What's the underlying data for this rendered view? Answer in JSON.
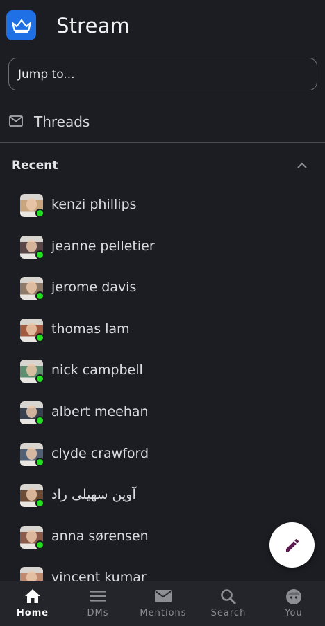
{
  "app": {
    "title": "Stream",
    "brand_color": "#1f6fe5"
  },
  "jump": {
    "placeholder": "Jump to..."
  },
  "threads": {
    "label": "Threads",
    "icon": "mail-icon"
  },
  "recent": {
    "heading": "Recent",
    "toggle_icon": "chevron-up-icon"
  },
  "dms": [
    {
      "name": "kenzi phillips",
      "online": true,
      "avatar_color": "#c9a57d"
    },
    {
      "name": "jeanne pelletier",
      "online": true,
      "avatar_color": "#5a4547"
    },
    {
      "name": "jerome davis",
      "online": true,
      "avatar_color": "#8f7a67"
    },
    {
      "name": "thomas lam",
      "online": true,
      "avatar_color": "#a35a40"
    },
    {
      "name": "nick campbell",
      "online": true,
      "avatar_color": "#5d8e6f"
    },
    {
      "name": "albert meehan",
      "online": true,
      "avatar_color": "#39414f"
    },
    {
      "name": "clyde crawford",
      "online": true,
      "avatar_color": "#516074"
    },
    {
      "name": "آوین سهیلی راد",
      "online": true,
      "avatar_color": "#6c4b37"
    },
    {
      "name": "anna sørensen",
      "online": true,
      "avatar_color": "#8a5a4a"
    },
    {
      "name": "vincent kumar",
      "online": true,
      "avatar_color": "#c08a70"
    }
  ],
  "fab": {
    "icon": "pencil-icon",
    "icon_color": "#5b1b4f"
  },
  "tabs": [
    {
      "label": "Home",
      "icon": "home-icon",
      "active": true
    },
    {
      "label": "DMs",
      "icon": "menu-icon",
      "active": false
    },
    {
      "label": "Mentions",
      "icon": "mail-icon",
      "active": false
    },
    {
      "label": "Search",
      "icon": "search-icon",
      "active": false
    },
    {
      "label": "You",
      "icon": "face-icon",
      "active": false
    }
  ]
}
